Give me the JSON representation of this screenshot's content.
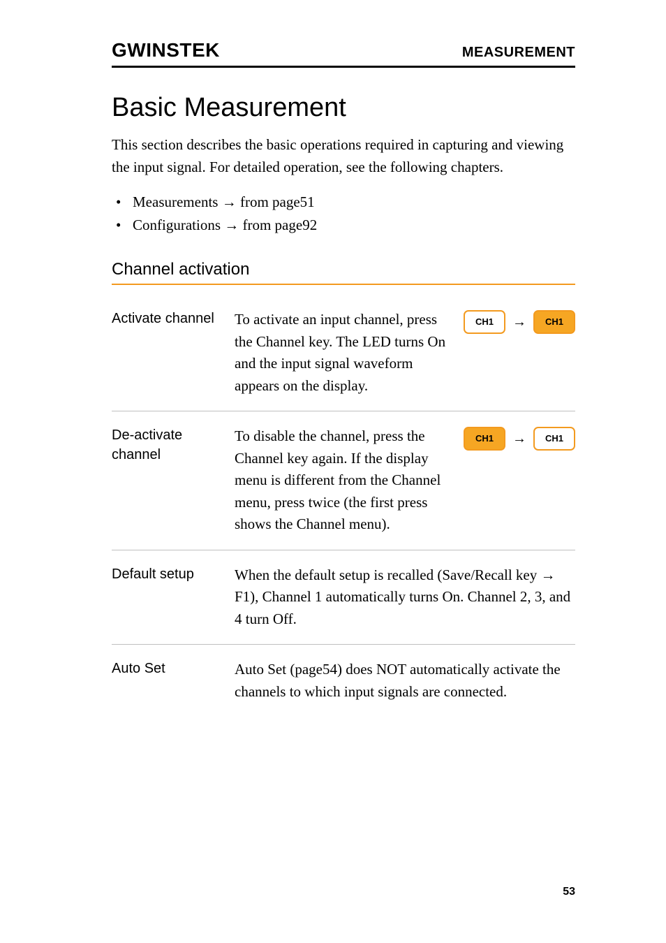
{
  "header": {
    "logo": "GWINSTEK",
    "section": "MEASUREMENT"
  },
  "title": "Basic Measurement",
  "intro": "This section describes the basic operations required in capturing and viewing the input signal. For detailed operation, see the following chapters.",
  "bullets": [
    "Measurements → from page51",
    "Configurations → from page92"
  ],
  "subsection_title": "Channel activation",
  "rows": {
    "activate": {
      "label": "Activate channel",
      "text": "To activate an input channel, press the Channel key. The LED turns On and the input signal waveform appears on the display.",
      "key_left": "CH1",
      "key_right": "CH1"
    },
    "deactivate": {
      "label": "De-activate channel",
      "text": "To disable the channel, press the Channel key again. If the display menu is different from the Channel menu, press twice (the first press shows the Channel menu).",
      "key_left": "CH1",
      "key_right": "CH1"
    },
    "default": {
      "label": "Default setup",
      "text": "When the default setup is recalled (Save/Recall key → F1), Channel 1 automatically turns On. Channel 2, 3, and 4 turn Off."
    },
    "autoset": {
      "label": "Auto Set",
      "text": "Auto Set (page54) does NOT automatically activate the channels to which input signals are connected."
    }
  },
  "page_number": "53"
}
